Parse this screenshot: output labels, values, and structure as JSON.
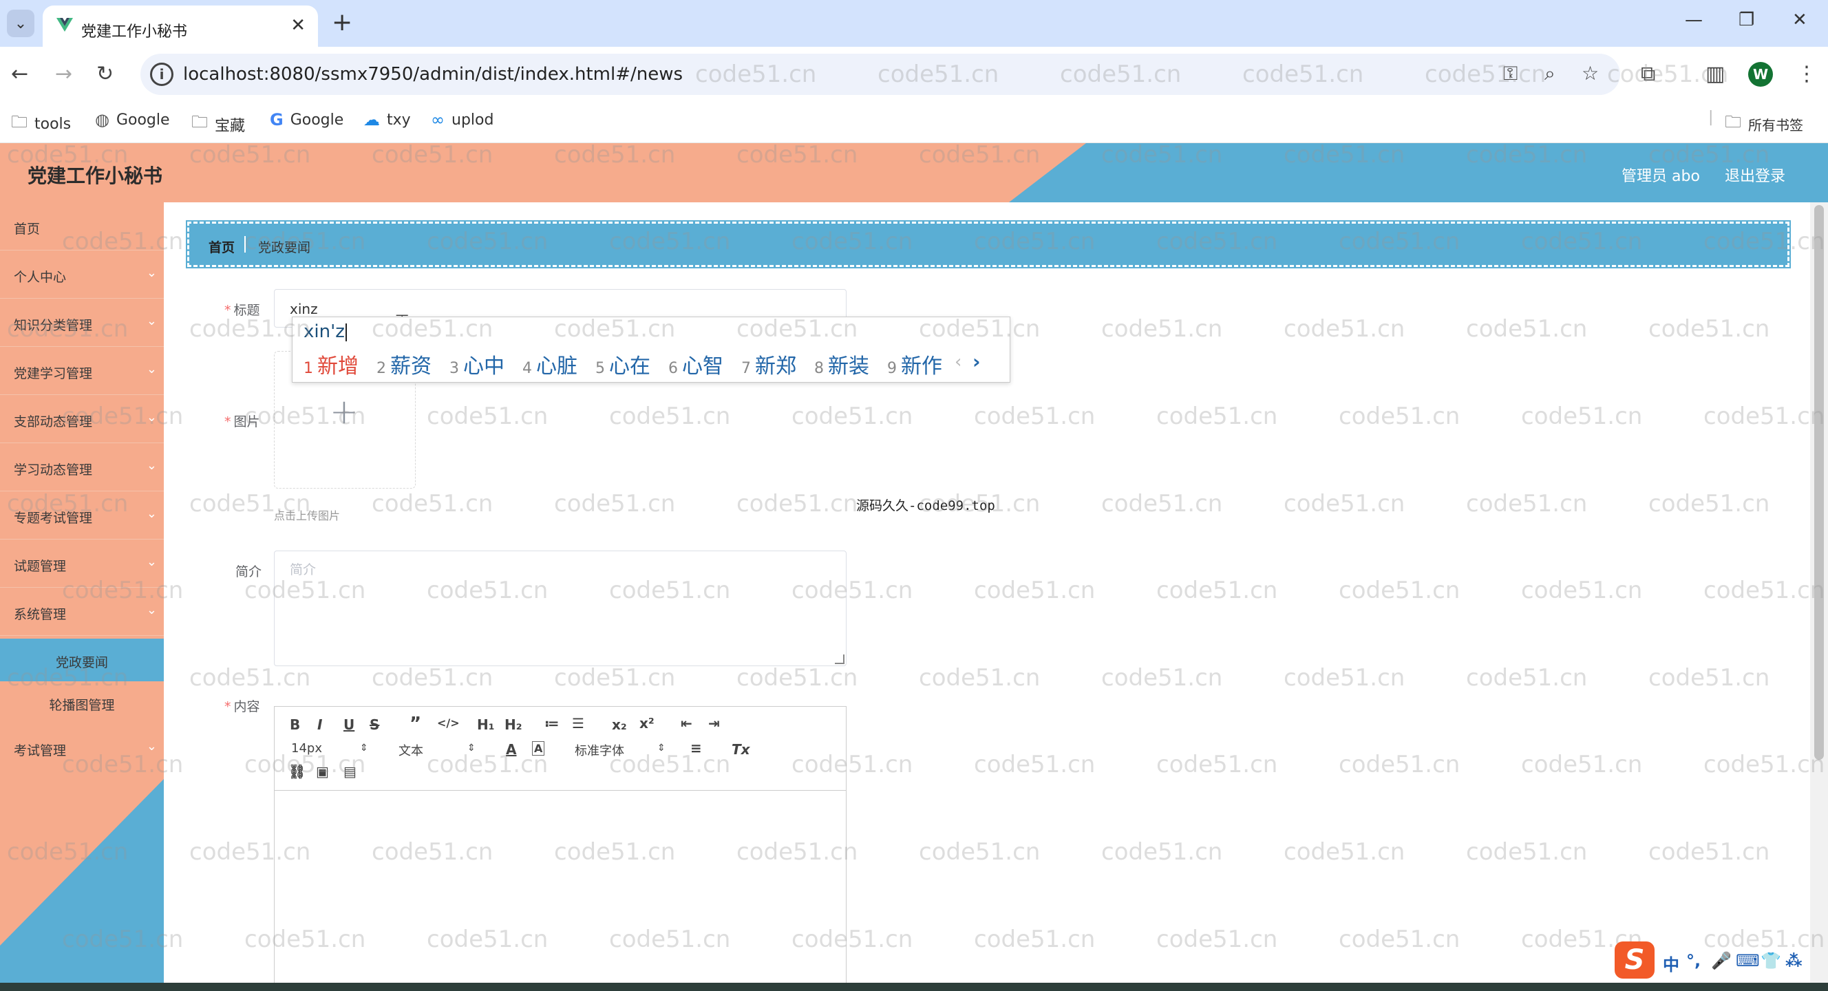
{
  "browser": {
    "tab_title": "党建工作小秘书",
    "url": "localhost:8080/ssmx7950/admin/dist/index.html#/news",
    "bookmarks": [
      "tools",
      "Google",
      "宝藏",
      "Google",
      "txy",
      "uplod"
    ],
    "all_bookmarks": "所有书签",
    "profile_initial": "W"
  },
  "header": {
    "app_title": "党建工作小秘书",
    "user": "管理员 abo",
    "logout": "退出登录"
  },
  "sidebar": {
    "items": [
      {
        "label": "首页"
      },
      {
        "label": "个人中心"
      },
      {
        "label": "知识分类管理"
      },
      {
        "label": "党建学习管理"
      },
      {
        "label": "支部动态管理"
      },
      {
        "label": "学习动态管理"
      },
      {
        "label": "专题考试管理"
      },
      {
        "label": "试题管理"
      },
      {
        "label": "系统管理"
      }
    ],
    "sub_items": [
      {
        "label": "党政要闻",
        "active": true
      },
      {
        "label": "轮播图管理",
        "active": false
      }
    ],
    "last_item": {
      "label": "考试管理"
    }
  },
  "breadcrumb": {
    "home": "首页",
    "current": "党政要闻"
  },
  "form": {
    "title_label": "标题",
    "title_value": "xinz",
    "image_label": "图片",
    "upload_tip": "点击上传图片",
    "intro_label": "简介",
    "intro_placeholder": "简介",
    "content_label": "内容"
  },
  "ime": {
    "pinyin": "xin'z",
    "candidates": [
      {
        "n": "1",
        "text": "新增"
      },
      {
        "n": "2",
        "text": "薪资"
      },
      {
        "n": "3",
        "text": "心中"
      },
      {
        "n": "4",
        "text": "心脏"
      },
      {
        "n": "5",
        "text": "心在"
      },
      {
        "n": "6",
        "text": "心智"
      },
      {
        "n": "7",
        "text": "新郑"
      },
      {
        "n": "8",
        "text": "新装"
      },
      {
        "n": "9",
        "text": "新作"
      }
    ],
    "prev": "‹",
    "next": "›"
  },
  "editor": {
    "font_size": "14px",
    "block_type": "文本",
    "font_family": "标准字体"
  },
  "watermark_text": "code51.cn",
  "center_watermark": "源码久久-code99.top",
  "tray": {
    "ime_lang": "中"
  },
  "colors": {
    "salmon": "#f6ab8c",
    "blue": "#5aaed4"
  }
}
